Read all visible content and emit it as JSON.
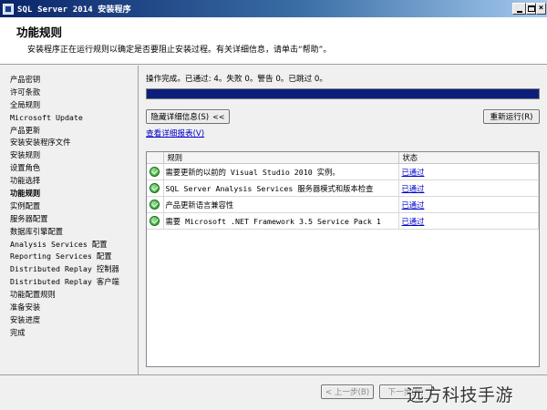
{
  "window": {
    "title": "SQL Server 2014 安装程序"
  },
  "header": {
    "heading": "功能规则",
    "description": "安装程序正在运行规则以确定是否要阻止安装过程。有关详细信息，请单击“帮助”。"
  },
  "nav": {
    "items": [
      "产品密钥",
      "许可条款",
      "全局规则",
      "Microsoft Update",
      "产品更新",
      "安装安装程序文件",
      "安装规则",
      "设置角色",
      "功能选择",
      "功能规则",
      "实例配置",
      "服务器配置",
      "数据库引擎配置",
      "Analysis Services 配置",
      "Reporting Services 配置",
      "Distributed Replay 控制器",
      "Distributed Replay 客户端",
      "功能配置规则",
      "准备安装",
      "安装进度",
      "完成"
    ],
    "active_index": 9
  },
  "main": {
    "status_text": "操作完成。已通过: 4。失败 0。警告 0。已跳过 0。",
    "progress_percent": 100,
    "hide_details_label": "隐藏详细信息(S)",
    "hide_details_chevron": "<<",
    "rerun_label": "重新运行(R)",
    "view_report_link": "查看详细报表(V)",
    "table": {
      "columns": [
        "规则",
        "状态"
      ],
      "rows": [
        {
          "rule": "需要更新的以前的 Visual Studio 2010 实例。",
          "status": "已通过",
          "icon": "check-success-icon"
        },
        {
          "rule": "SQL Server Analysis Services 服务器模式和版本检查",
          "status": "已通过",
          "icon": "check-success-icon"
        },
        {
          "rule": "产品更新语言兼容性",
          "status": "已通过",
          "icon": "check-success-icon"
        },
        {
          "rule": "需要 Microsoft .NET Framework 3.5 Service Pack 1",
          "status": "已通过",
          "icon": "check-success-icon"
        }
      ]
    }
  },
  "footer": {
    "back_label": "< 上一步(B)",
    "next_label": "下一步(N)",
    "watermark": "远方科技手游"
  },
  "colors": {
    "progress": "#0b1f7a",
    "link": "#0000cc",
    "success": "#1f9a1f"
  }
}
